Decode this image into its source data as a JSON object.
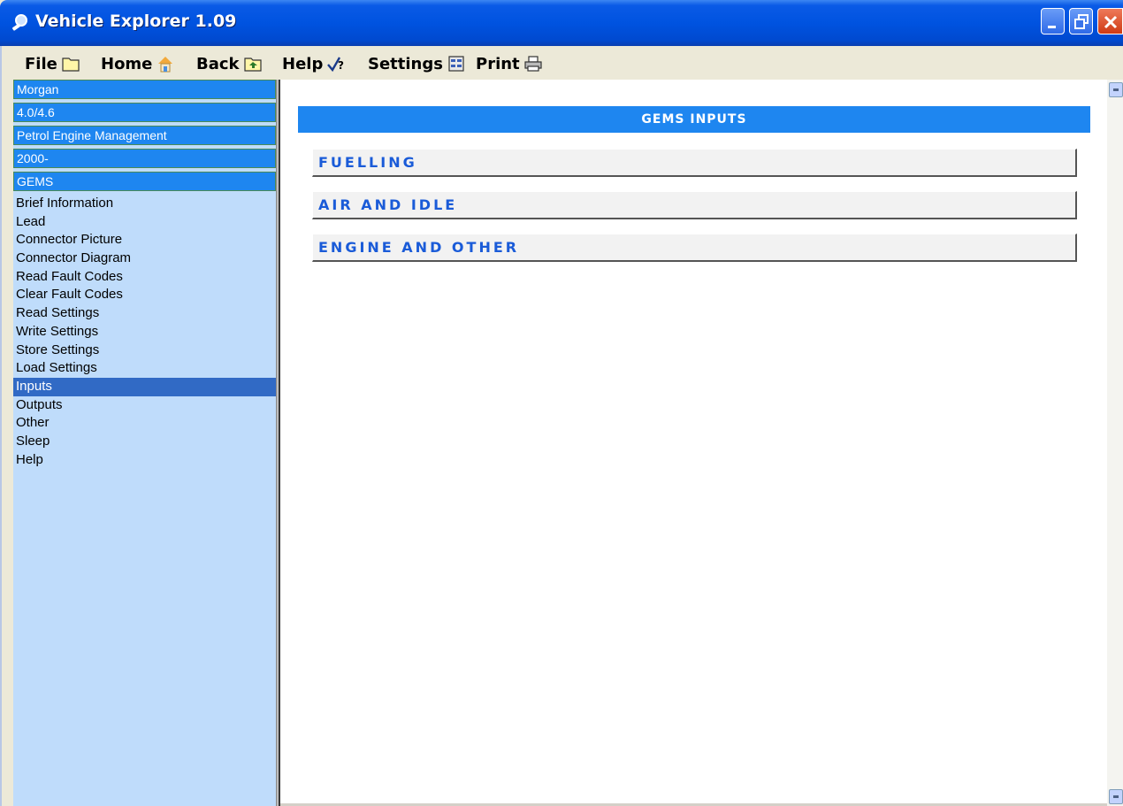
{
  "window": {
    "title": "Vehicle Explorer 1.09",
    "controls": [
      "minimize-icon",
      "restore-icon",
      "close-icon"
    ]
  },
  "menu": {
    "items": [
      {
        "label": "File",
        "icon": "folder-icon"
      },
      {
        "label": "Home",
        "icon": "home-icon"
      },
      {
        "label": "Back",
        "icon": "back-icon"
      },
      {
        "label": "Help",
        "icon": "help-icon"
      },
      {
        "label": "Settings",
        "icon": "settings-icon"
      },
      {
        "label": "Print",
        "icon": "printer-icon"
      }
    ]
  },
  "sidebar": {
    "breadcrumbs": [
      "Morgan",
      "4.0/4.6",
      "Petrol Engine Management",
      "2000-",
      "GEMS"
    ],
    "items": [
      {
        "label": "Brief Information"
      },
      {
        "label": "Lead"
      },
      {
        "label": "Connector Picture"
      },
      {
        "label": "Connector Diagram"
      },
      {
        "label": "Read Fault Codes"
      },
      {
        "label": "Clear Fault Codes"
      },
      {
        "label": "Read Settings"
      },
      {
        "label": "Write Settings"
      },
      {
        "label": "Store Settings"
      },
      {
        "label": "Load Settings"
      },
      {
        "label": "Inputs",
        "selected": true
      },
      {
        "label": "Outputs"
      },
      {
        "label": "Other"
      },
      {
        "label": "Sleep"
      },
      {
        "label": "Help"
      }
    ]
  },
  "main": {
    "heading": "GEMS INPUTS",
    "sections": [
      "FUELLING",
      "AIR AND IDLE",
      "ENGINE AND OTHER"
    ]
  },
  "colors": {
    "accent_blue": "#1e86f0",
    "sidebar_bg": "#bfdcfb",
    "selected_bg": "#316ac5",
    "section_text": "#1a5bd8"
  }
}
